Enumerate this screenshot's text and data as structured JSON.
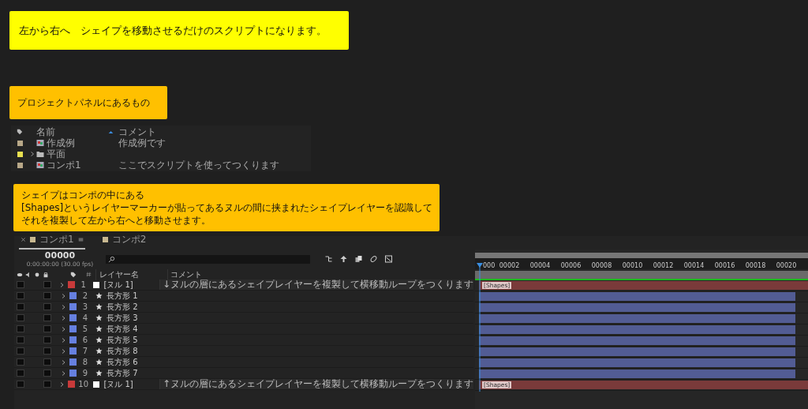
{
  "notes": [
    {
      "text": "左から右へ　シェイプを移動させるだけのスクリプトになります。",
      "color": "#ffff00"
    },
    {
      "text": "プロジェクトパネルにあるもの",
      "color": "#ffc000"
    }
  ],
  "project_panel": {
    "columns": [
      "名前",
      "コメント"
    ],
    "items": [
      {
        "kind": "comp",
        "name": "作成例",
        "comment": "作成例です",
        "color": "#b8a888"
      },
      {
        "kind": "folder",
        "name": "平面",
        "color": "#e8e050",
        "expanded": false
      },
      {
        "kind": "comp",
        "name": "コンポ1",
        "comment": "ここでスクリプトを使ってつくります",
        "color": "#b8a888"
      }
    ]
  },
  "explanation": {
    "lines": [
      "シェイプはコンポの中にある",
      "[Shapes]というレイヤーマーカーが貼ってあるヌルの間に挟まれたシェイプレイヤーを認識して",
      "それを複製して左から右へと移動させます。"
    ],
    "color": "#ffc000"
  },
  "timeline": {
    "tabs": [
      {
        "label": "コンポ1",
        "selected": true
      },
      {
        "label": "コンポ2",
        "selected": false
      }
    ],
    "timecode": "00000",
    "time_detail": "0:00:00:00 (30.00 fps)",
    "columns": [
      "レイヤー名",
      "コメント"
    ],
    "ruler": [
      "000",
      "00002",
      "00004",
      "00006",
      "00008",
      "00010",
      "00012",
      "00014",
      "00016",
      "00018",
      "00020"
    ],
    "layers": [
      {
        "number": "1",
        "kind": "null",
        "name": "[ヌル 1]",
        "comment": "↓ヌルの層にあるシェイプレイヤーを複製して横移動ループをつくります",
        "color": "#c83a3a",
        "marker": "[Shapes]"
      },
      {
        "number": "2",
        "kind": "shape",
        "name": "長方形 1",
        "color": "#6680e0"
      },
      {
        "number": "3",
        "kind": "shape",
        "name": "長方形 2",
        "color": "#6680e0"
      },
      {
        "number": "4",
        "kind": "shape",
        "name": "長方形 3",
        "color": "#6680e0"
      },
      {
        "number": "5",
        "kind": "shape",
        "name": "長方形 4",
        "color": "#6680e0"
      },
      {
        "number": "6",
        "kind": "shape",
        "name": "長方形 5",
        "color": "#6680e0"
      },
      {
        "number": "7",
        "kind": "shape",
        "name": "長方形 8",
        "color": "#6680e0"
      },
      {
        "number": "8",
        "kind": "shape",
        "name": "長方形 6",
        "color": "#6680e0"
      },
      {
        "number": "9",
        "kind": "shape",
        "name": "長方形 7",
        "color": "#6680e0"
      },
      {
        "number": "10",
        "kind": "null",
        "name": "[ヌル 1]",
        "comment": "↑ヌルの層にあるシェイプレイヤーを複製して横移動ループをつくります",
        "color": "#c83a3a",
        "marker": "[Shapes]"
      }
    ]
  }
}
